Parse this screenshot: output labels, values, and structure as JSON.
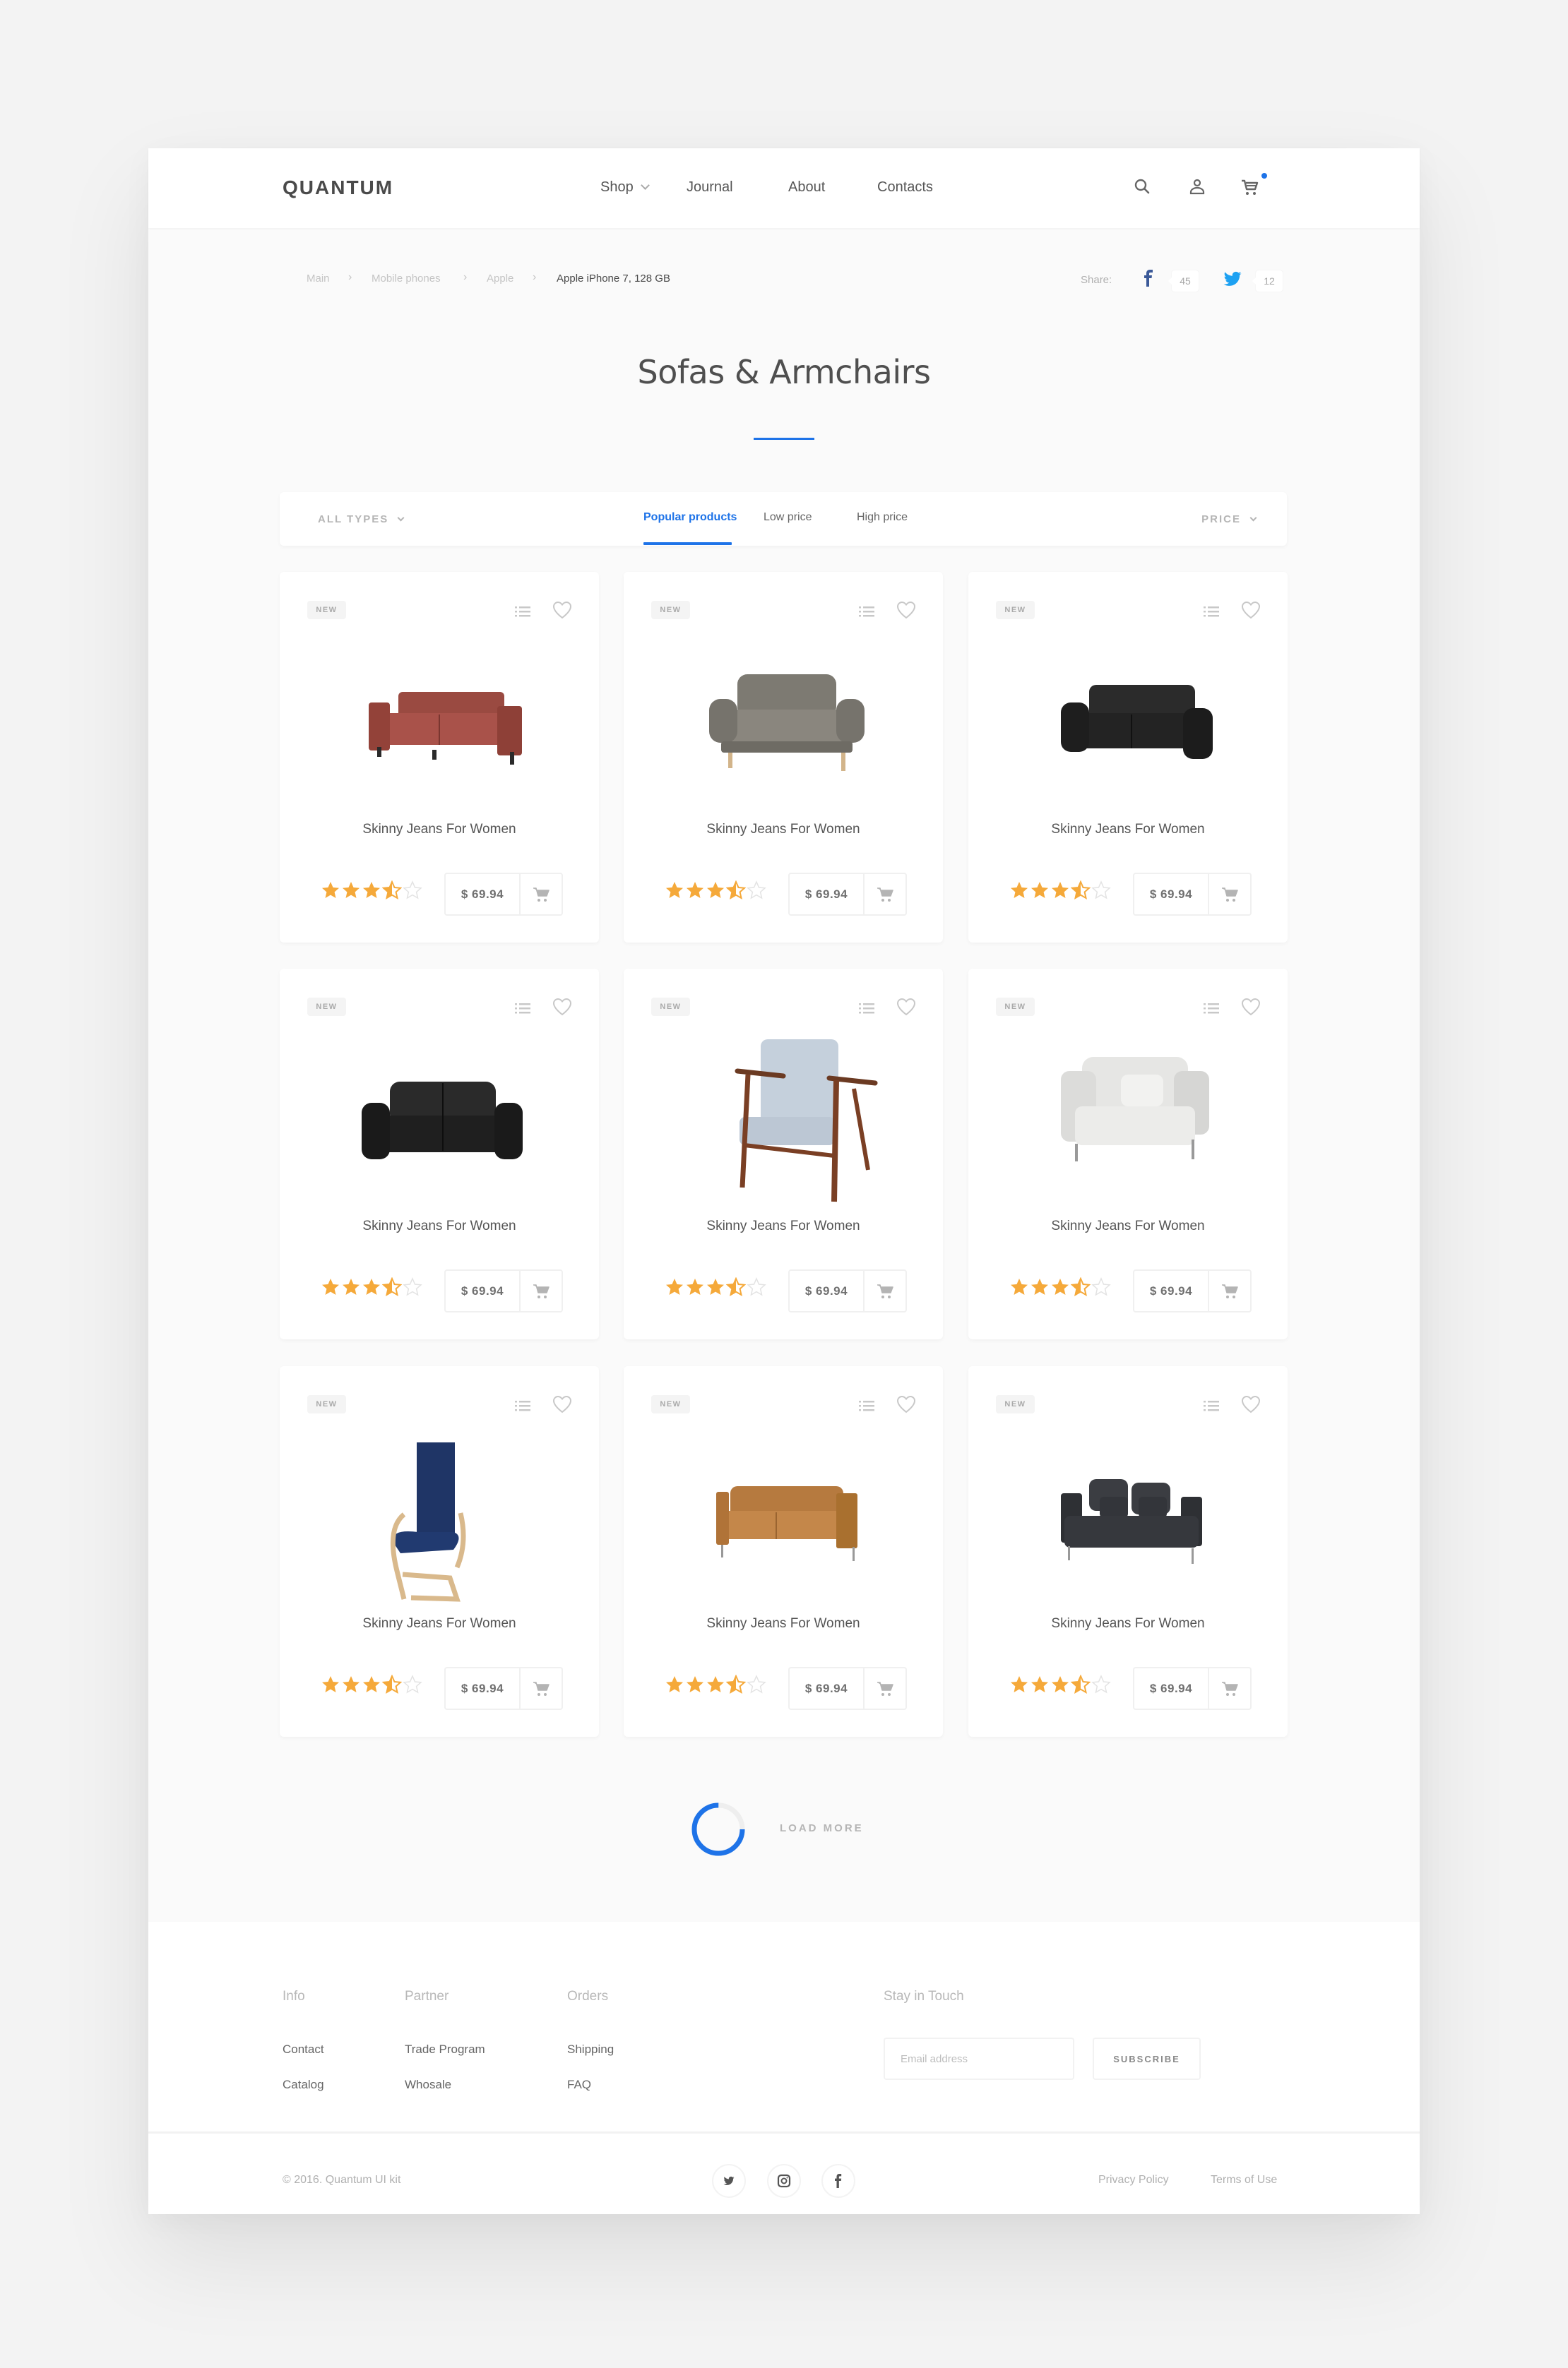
{
  "header": {
    "logo": "QUANTUM",
    "nav": [
      {
        "label": "Shop",
        "has_dropdown": true
      },
      {
        "label": "Journal"
      },
      {
        "label": "About"
      },
      {
        "label": "Contacts"
      }
    ],
    "icons": [
      "search-icon",
      "user-icon",
      "cart-icon"
    ],
    "cart_has_notification": true
  },
  "breadcrumb": {
    "items": [
      "Main",
      "Mobile phones",
      "Apple",
      "Apple iPhone 7, 128 GB"
    ],
    "separator": "›"
  },
  "share": {
    "label": "Share:",
    "facebook_count": "45",
    "twitter_count": "12"
  },
  "page_title": "Sofas & Armchairs",
  "filters": {
    "type_select": "ALL TYPES",
    "sort_tabs": [
      {
        "label": "Popular products",
        "active": true
      },
      {
        "label": "Low price",
        "active": false
      },
      {
        "label": "High price",
        "active": false
      }
    ],
    "price_select": "PRICE"
  },
  "products": [
    {
      "badge": "NEW",
      "name": "Skinny Jeans For Women",
      "price": "$ 69.94",
      "rating": 3.5,
      "rating_max": 5,
      "image": "red-sofa"
    },
    {
      "badge": "NEW",
      "name": "Skinny Jeans For Women",
      "price": "$ 69.94",
      "rating": 3.5,
      "rating_max": 5,
      "image": "grey-loveseat"
    },
    {
      "badge": "NEW",
      "name": "Skinny Jeans For Women",
      "price": "$ 69.94",
      "rating": 3.5,
      "rating_max": 5,
      "image": "black-leather-sofa"
    },
    {
      "badge": "NEW",
      "name": "Skinny Jeans For Women",
      "price": "$ 69.94",
      "rating": 3.5,
      "rating_max": 5,
      "image": "black-leather-loveseat"
    },
    {
      "badge": "NEW",
      "name": "Skinny Jeans For Women",
      "price": "$ 69.94",
      "rating": 3.5,
      "rating_max": 5,
      "image": "wooden-armchair"
    },
    {
      "badge": "NEW",
      "name": "Skinny Jeans For Women",
      "price": "$ 69.94",
      "rating": 3.5,
      "rating_max": 5,
      "image": "white-corner-chair"
    },
    {
      "badge": "NEW",
      "name": "Skinny Jeans For Women",
      "price": "$ 69.94",
      "rating": 3.5,
      "rating_max": 5,
      "image": "blue-bentwood-chair"
    },
    {
      "badge": "NEW",
      "name": "Skinny Jeans For Women",
      "price": "$ 69.94",
      "rating": 3.5,
      "rating_max": 5,
      "image": "tan-leather-sofa"
    },
    {
      "badge": "NEW",
      "name": "Skinny Jeans For Women",
      "price": "$ 69.94",
      "rating": 3.5,
      "rating_max": 5,
      "image": "charcoal-sofa"
    }
  ],
  "load_more": {
    "label": "LOAD MORE",
    "progress": 0.75
  },
  "footer": {
    "columns": [
      {
        "heading": "Info",
        "links": [
          "Contact",
          "Catalog"
        ]
      },
      {
        "heading": "Partner",
        "links": [
          "Trade Program",
          "Whosale"
        ]
      },
      {
        "heading": "Orders",
        "links": [
          "Shipping",
          "FAQ"
        ]
      }
    ],
    "newsletter": {
      "heading": "Stay in Touch",
      "email_placeholder": "Email address",
      "email_value": "",
      "button": "SUBSCRIBE"
    },
    "copyright": "© 2016. Quantum UI kit",
    "social": [
      "twitter-icon",
      "instagram-icon",
      "facebook-icon"
    ],
    "legal": [
      "Privacy Policy",
      "Terms of Use"
    ]
  },
  "colors": {
    "accent": "#1e73e8",
    "star": "#f5a93a",
    "facebook": "#3b5998",
    "twitter": "#1da1f2"
  }
}
